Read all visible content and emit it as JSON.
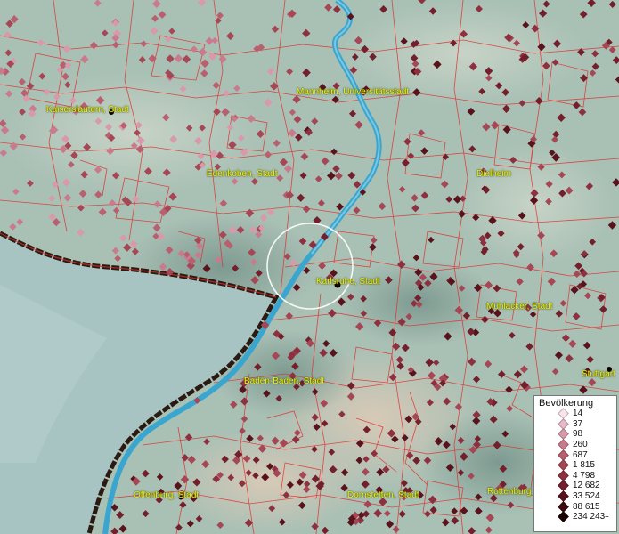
{
  "map": {
    "places": [
      {
        "id": "kaiserslautern",
        "name": "Kaiserslautern, Stadt"
      },
      {
        "id": "mannheim",
        "name": "Mannheim, Universitätsstadt"
      },
      {
        "id": "edenkoben",
        "name": "Edenkoben, Stadt"
      },
      {
        "id": "dielheim",
        "name": "Dielheim"
      },
      {
        "id": "karlsruhe",
        "name": "Karlsruhe, Stadt"
      },
      {
        "id": "muehlacker",
        "name": "Mühlacker, Stadt"
      },
      {
        "id": "baden-baden",
        "name": "Baden-Baden, Stadt"
      },
      {
        "id": "stuttgart",
        "name": "Stuttgart"
      },
      {
        "id": "offenburg",
        "name": "Offenburg, Stadt"
      },
      {
        "id": "dornstetten",
        "name": "Dornstetten, Stadt"
      },
      {
        "id": "rottenburg",
        "name": "Rottenburg"
      }
    ]
  },
  "legend": {
    "title": "Bevölkerung",
    "entries": [
      {
        "label": "14",
        "color": "#f9e4ec"
      },
      {
        "label": "37",
        "color": "#e8b9c8"
      },
      {
        "label": "98",
        "color": "#d89aab"
      },
      {
        "label": "260",
        "color": "#c97b8d"
      },
      {
        "label": "687",
        "color": "#b8606f"
      },
      {
        "label": "1 815",
        "color": "#a54755"
      },
      {
        "label": "4 798",
        "color": "#8d3140"
      },
      {
        "label": "12 682",
        "color": "#731f2c"
      },
      {
        "label": "33 524",
        "color": "#58131c"
      },
      {
        "label": "88 615",
        "color": "#3c0a10"
      },
      {
        "label": "234 243",
        "color": "#1a0305",
        "suffix": "+"
      }
    ]
  },
  "colors": {
    "terrain": "#a9c0b5",
    "france": "#a7c4c2",
    "rhine": "#3aa6cf",
    "municipal_border": "#e0302d",
    "state_border": "#2a1a12"
  }
}
